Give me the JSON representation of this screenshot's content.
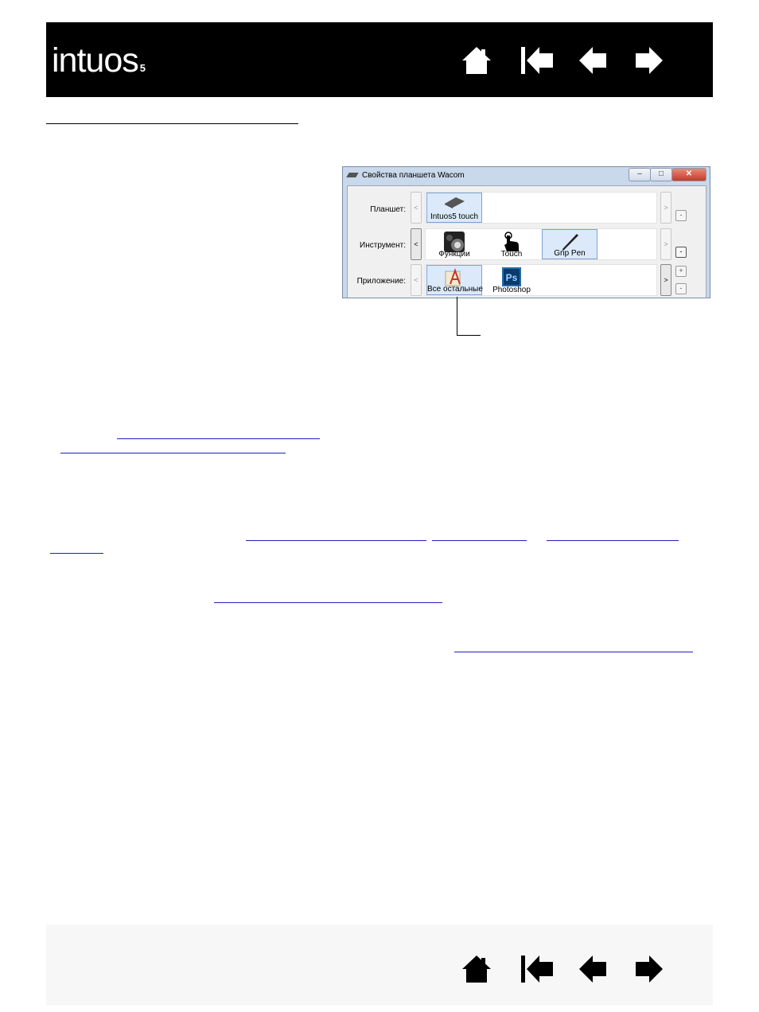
{
  "header": {
    "logo_text": "intuos",
    "logo_suffix": "5",
    "background": "#000000",
    "nav_icons": [
      "home-icon",
      "first-page-icon",
      "previous-page-icon",
      "next-page-icon"
    ]
  },
  "dialog": {
    "title": "Свойства планшета Wacom",
    "window_buttons": [
      "‒",
      "□",
      "✕"
    ],
    "rows": [
      {
        "label": "Планшет:",
        "tiles": [
          {
            "label": "Intuos5 touch",
            "icon": "tablet-icon",
            "selected": true
          }
        ],
        "left_arrow": "<",
        "right_arrow": ">",
        "side_buttons": [
          "-"
        ]
      },
      {
        "label": "Инструмент:",
        "tiles": [
          {
            "label": "Функции",
            "icon": "functions-icon",
            "selected": false
          },
          {
            "label": "Touch",
            "icon": "touch-hand-icon",
            "selected": false
          },
          {
            "label": "Grip Pen",
            "icon": "pen-icon",
            "selected": true
          }
        ],
        "left_arrow": "<",
        "right_arrow": ">",
        "side_buttons": [
          "-"
        ]
      },
      {
        "label": "Приложение:",
        "tiles": [
          {
            "label": "Все остальные",
            "icon": "all-apps-icon",
            "selected": true
          },
          {
            "label": "Photoshop",
            "icon": "photoshop-icon",
            "selected": false
          }
        ],
        "left_arrow": "<",
        "right_arrow": ">",
        "side_buttons": [
          "+",
          "-"
        ]
      }
    ],
    "photoshop_icon_text": "Ps"
  },
  "footer": {
    "nav_icons": [
      "home-icon",
      "first-page-icon",
      "previous-page-icon",
      "next-page-icon"
    ]
  }
}
